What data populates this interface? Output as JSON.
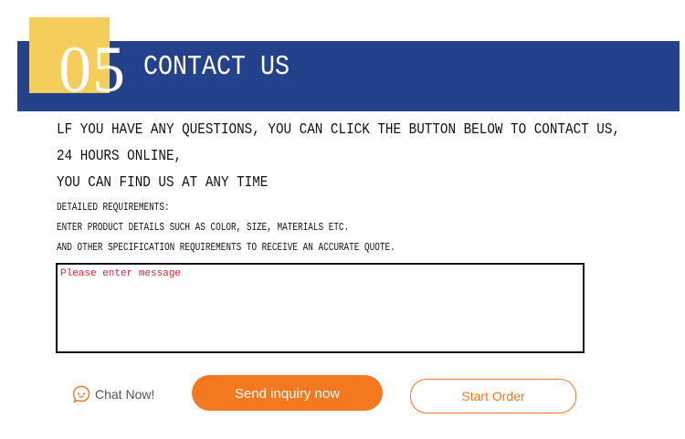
{
  "section": {
    "number": "05",
    "title": "CONTACT US"
  },
  "intro": {
    "line1": "LF YOU HAVE ANY QUESTIONS, YOU CAN CLICK THE BUTTON BELOW TO CONTACT US,",
    "line2": "24 HOURS ONLINE,",
    "line3": "YOU CAN FIND US AT ANY TIME"
  },
  "requirements": {
    "heading": "DETAILED REQUIREMENTS:",
    "line1": "ENTER PRODUCT DETAILS SUCH AS COLOR, SIZE, MATERIALS ETC.",
    "line2": "AND OTHER SPECIFICATION REQUIREMENTS TO RECEIVE AN ACCURATE QUOTE."
  },
  "message": {
    "value": "",
    "placeholder": "Please enter message"
  },
  "actions": {
    "chat_label": "Chat Now!",
    "chat_icon": "chat-bubble-icon",
    "send_label": "Send inquiry now",
    "order_label": "Start Order"
  },
  "colors": {
    "header_blue": "#24418c",
    "accent_yellow": "#f5cd5b",
    "accent_orange": "#f47820",
    "placeholder_red": "#e0202a"
  }
}
